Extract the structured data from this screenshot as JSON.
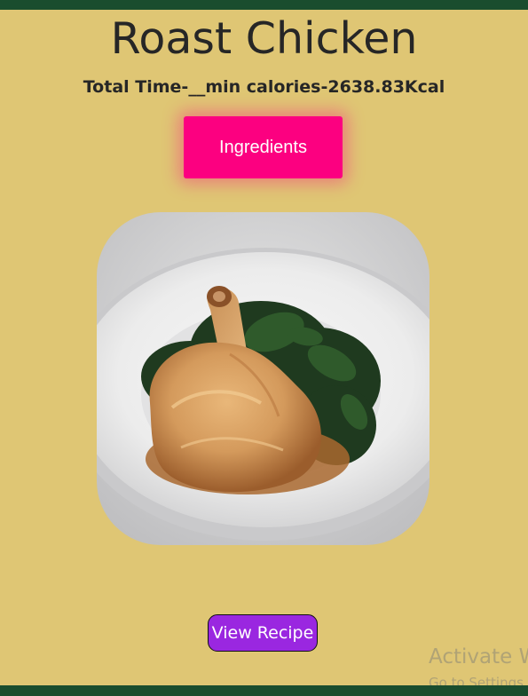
{
  "recipe": {
    "title": "Roast Chicken",
    "subtitle": "Total Time-__min calories-2638.83Kcal"
  },
  "buttons": {
    "ingredients_label": "Ingredients",
    "view_recipe_label": "View Recipe"
  },
  "image": {
    "description_icon": "roast-chicken-photo"
  },
  "watermark": {
    "line1": "Activate Windows",
    "line2": "Go to Settings to activate Windows."
  },
  "colors": {
    "background": "#dfc674",
    "bar": "#1a4d2e",
    "ingredients_button": "#fc0080",
    "view_recipe_button": "#9a27e0"
  }
}
